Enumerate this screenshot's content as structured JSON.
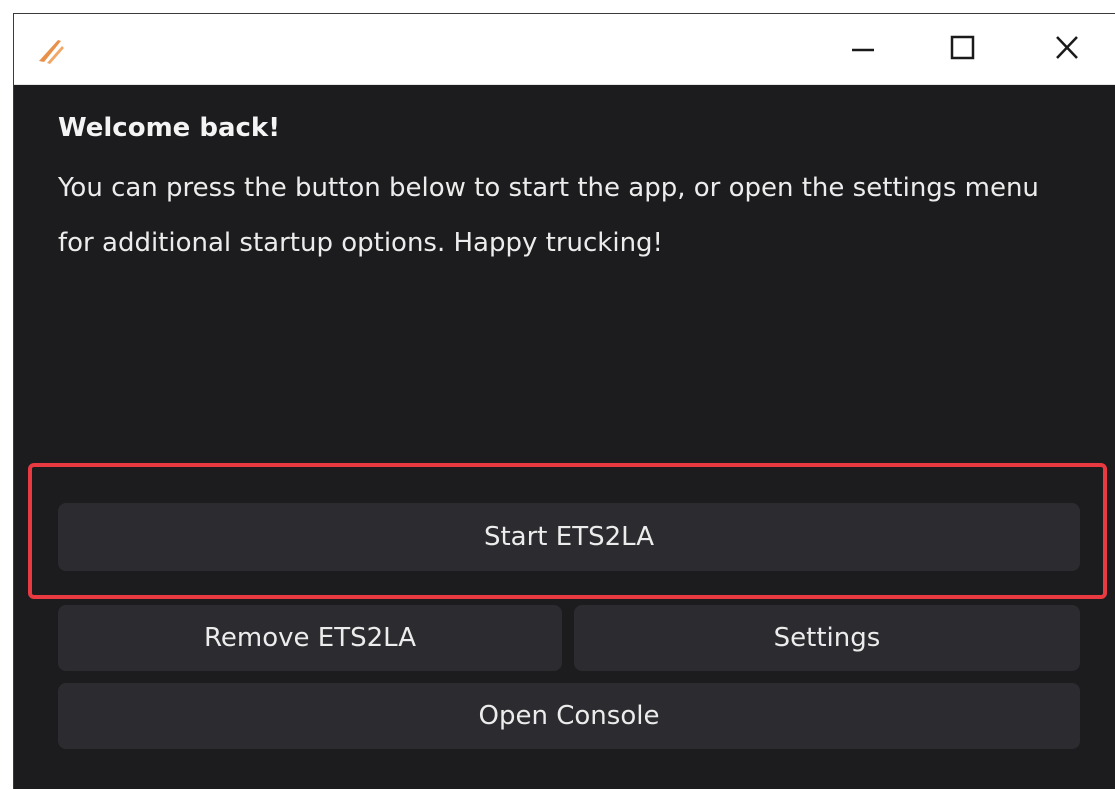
{
  "titlebar": {
    "logo_icon": "ets2la-logo-icon",
    "minimize_icon": "minimize-icon",
    "maximize_icon": "maximize-icon",
    "close_icon": "close-icon"
  },
  "welcome": {
    "title": "Welcome back!",
    "message": "You can press the button below to start the app, or open the settings menu for additional startup options. Happy trucking!"
  },
  "buttons": {
    "start": "Start ETS2LA",
    "remove": "Remove ETS2LA",
    "settings": "Settings",
    "console": "Open Console"
  },
  "colors": {
    "background": "#1c1c1e",
    "button": "#2c2c30",
    "highlight": "#e83a40",
    "logo": "#e8914a"
  }
}
